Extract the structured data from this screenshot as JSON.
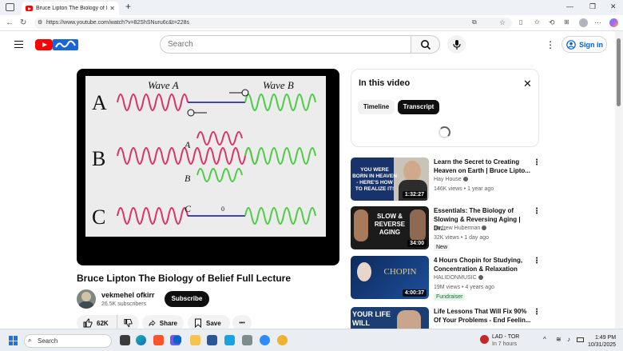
{
  "browser": {
    "tab_title": "Bruce Lipton The Biology of Belief",
    "tab_close": "✕",
    "new_tab": "+",
    "url": "https://www.youtube.com/watch?v=82ShSNuru6c&t=228s"
  },
  "youtube": {
    "search_placeholder": "Search",
    "sign_in": "Sign in",
    "more": "⋮"
  },
  "slide": {
    "labels": [
      "A",
      "B",
      "C"
    ],
    "wave_a": "Wave A",
    "wave_b": "Wave B",
    "mid_labels": [
      "A",
      "B",
      "C"
    ],
    "zero": "0"
  },
  "video": {
    "title": "Bruce Lipton The Biology of Belief Full Lecture",
    "channel": "vekmehel ofkirr",
    "subscribers": "26.5K subscribers",
    "subscribe": "Subscribe",
    "likes": "62K",
    "share": "Share",
    "save": "Save",
    "more": "•••"
  },
  "panel": {
    "title": "In this video",
    "chips": [
      "Timeline",
      "Transcript"
    ]
  },
  "recommendations": [
    {
      "title": "Learn the Secret to Creating Heaven on Earth | Bruce Lipto...",
      "channel": "Hay House",
      "meta": "146K views • 1 year ago",
      "duration": "1:32:27",
      "thumb_text": "YOU WERE BORN IN HEAVEN - HERE'S HOW TO REALIZE IT!",
      "badge": ""
    },
    {
      "title": "Essentials: The Biology of Slowing & Reversing Aging | Dr...",
      "channel": "Andrew Huberman",
      "meta": "32K views • 1 day ago",
      "duration": "34:00",
      "thumb_text": "SLOW & REVERSE AGING",
      "badge": "New"
    },
    {
      "title": "4 Hours Chopin for Studying, Concentration & Relaxation",
      "channel": "HALIDONMUSIC",
      "meta": "19M views • 4 years ago",
      "duration": "4:00:37",
      "thumb_text": "CHOPIN",
      "badge": "Fundraiser"
    },
    {
      "title": "Life Lessons That Will Fix 90% Of Your Problems - End Feelin...",
      "channel": "",
      "meta": "",
      "duration": "",
      "thumb_text": "YOUR LIFE WILL NEVER",
      "badge": ""
    }
  ],
  "taskbar": {
    "search": "Search",
    "weather_line1": "LAD - TOR",
    "weather_line2": "In 7 hours",
    "time": "1:49 PM",
    "date": "10/31/2025"
  }
}
